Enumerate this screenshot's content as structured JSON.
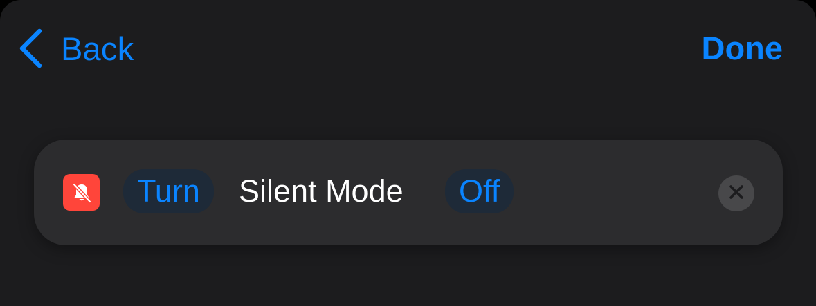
{
  "nav": {
    "back_label": "Back",
    "done_label": "Done"
  },
  "action": {
    "icon": "bell-slash-icon",
    "icon_color": "#ff453a",
    "verb": "Turn",
    "subject": "Silent Mode",
    "state": "Off",
    "remove_icon": "close-icon"
  },
  "colors": {
    "accent": "#0a84ff",
    "background": "#1c1c1e",
    "card": "#2c2c2e"
  }
}
